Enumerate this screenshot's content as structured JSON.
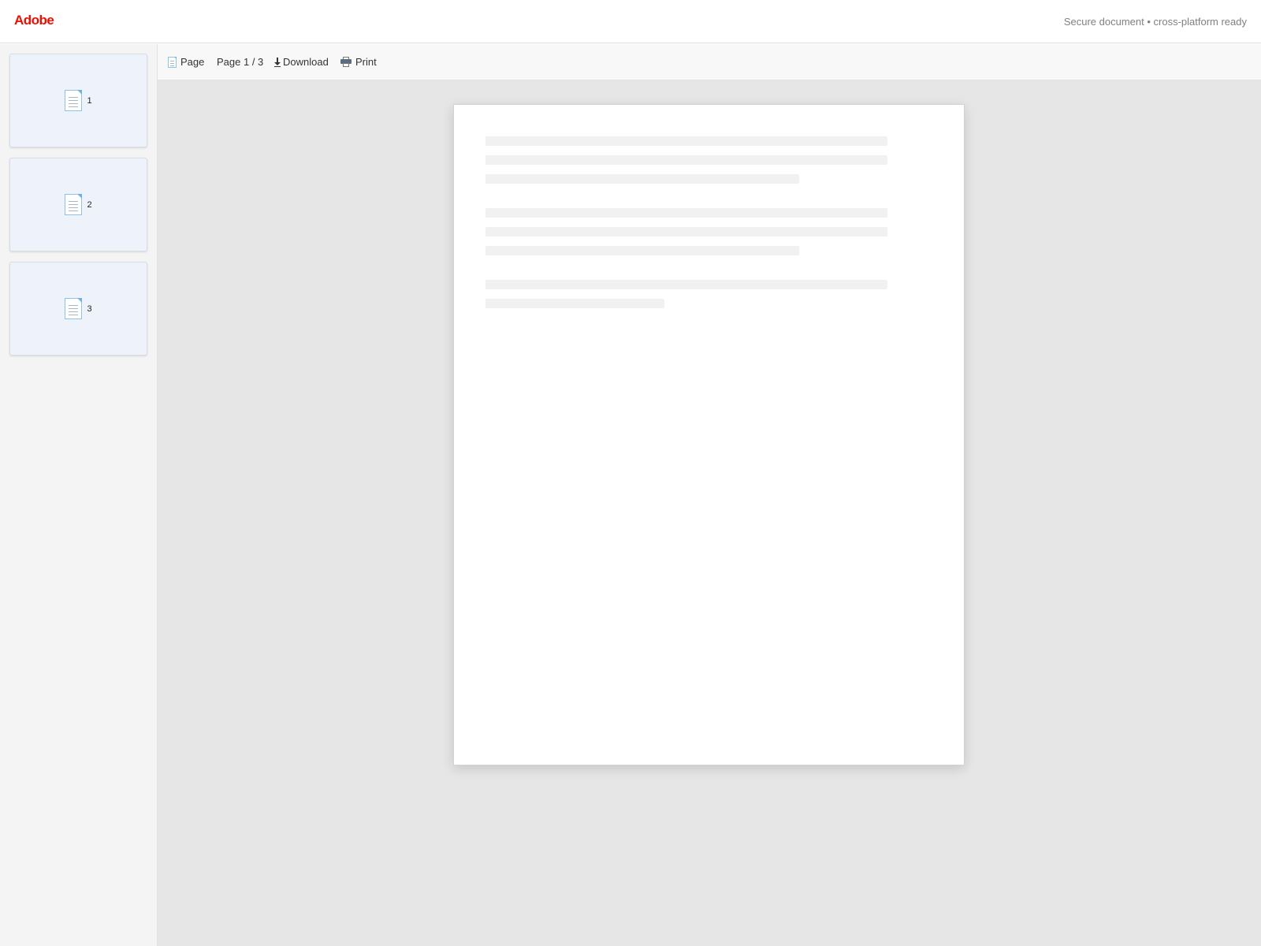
{
  "header": {
    "logo_text": "Adobe",
    "status_text": "Secure document • cross-platform ready",
    "brand_color": "#eb1000"
  },
  "toolbar": {
    "page_label": "Page",
    "page_indicator": "Page 1 / 3",
    "download_label": "Download",
    "print_label": "Print"
  },
  "sidebar": {
    "thumbnails": [
      {
        "label": "1",
        "icon": "document-icon"
      },
      {
        "label": "2",
        "icon": "document-icon"
      },
      {
        "label": "3",
        "icon": "document-icon"
      }
    ]
  },
  "document": {
    "current_page": 1,
    "total_pages": 3
  }
}
